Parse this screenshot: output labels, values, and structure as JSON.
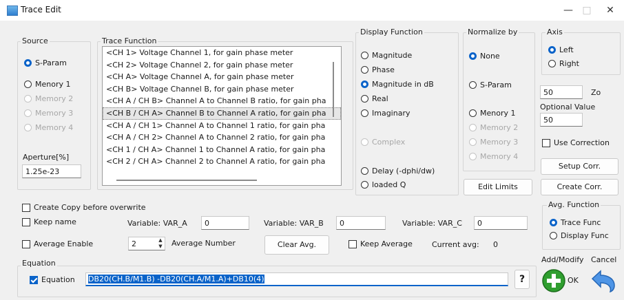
{
  "window": {
    "title": "Trace Edit",
    "minimize": "—",
    "maximize": "□",
    "close": "✕"
  },
  "source": {
    "label": "Source",
    "options": [
      {
        "label": "S-Param",
        "selected": true,
        "disabled": false
      },
      {
        "label": "Menory 1",
        "selected": false,
        "disabled": false
      },
      {
        "label": "Memory 2",
        "selected": false,
        "disabled": true
      },
      {
        "label": "Memory 3",
        "selected": false,
        "disabled": true
      },
      {
        "label": "Memory 4",
        "selected": false,
        "disabled": true
      }
    ],
    "aperture_label": "Aperture[%]",
    "aperture_value": "1.25e-23"
  },
  "trace_function": {
    "label": "Trace Function",
    "items": [
      "<CH 1> Voltage Channel 1, for gain phase meter",
      "<CH 2> Voltage Channel 2, for gain phase meter",
      "<CH A> Voltage Channel A, for gain phase meter",
      "<CH B> Voltage Channel B, for gain phase meter",
      "<CH A / CH B> Channel A to Channel B ratio, for gain pha",
      "<CH B / CH A> Channel B to Channel A ratio, for gain pha",
      "<CH A / CH 1> Channel A to Channel 1 ratio, for gain pha",
      "<CH A / CH 2> Channel A to Channel 2 ratio, for gain pha",
      "<CH 1 / CH A> Channel 1 to Channel A ratio, for gain pha",
      "<CH 2 / CH A> Channel 2 to Channel A ratio, for gain pha"
    ],
    "selected_index": 5
  },
  "display_function": {
    "label": "Display Function",
    "options": [
      {
        "label": "Magnitude",
        "selected": false,
        "disabled": false
      },
      {
        "label": "Phase",
        "selected": false,
        "disabled": false
      },
      {
        "label": "Magnitude in dB",
        "selected": true,
        "disabled": false
      },
      {
        "label": "Real",
        "selected": false,
        "disabled": false
      },
      {
        "label": "Imaginary",
        "selected": false,
        "disabled": false
      },
      {
        "label": "Complex",
        "selected": false,
        "disabled": true
      },
      {
        "label": "Delay (-dphi/dw)",
        "selected": false,
        "disabled": false
      },
      {
        "label": "loaded Q",
        "selected": false,
        "disabled": false
      }
    ]
  },
  "normalize_by": {
    "label": "Normalize by",
    "options": [
      {
        "label": "None",
        "selected": true,
        "disabled": false
      },
      {
        "label": "S-Param",
        "selected": false,
        "disabled": false
      },
      {
        "label": "Menory 1",
        "selected": false,
        "disabled": false
      },
      {
        "label": "Memory 2",
        "selected": false,
        "disabled": true
      },
      {
        "label": "Memory 3",
        "selected": false,
        "disabled": true
      },
      {
        "label": "Memory 4",
        "selected": false,
        "disabled": true
      }
    ],
    "edit_limits": "Edit Limits"
  },
  "axis": {
    "label": "Axis",
    "options": [
      {
        "label": "Left",
        "selected": true
      },
      {
        "label": "Right",
        "selected": false
      }
    ],
    "zo_value": "50",
    "zo_label": "Zo",
    "optional_label": "Optional Value",
    "optional_value": "50",
    "use_correction": "Use Correction",
    "setup_corr": "Setup Corr.",
    "create_corr": "Create Corr."
  },
  "options": {
    "create_copy": "Create Copy before overwrite",
    "keep_name": "Keep name",
    "var_a_label": "Variable: VAR_A",
    "var_a_value": "0",
    "var_b_label": "Variable: VAR_B",
    "var_b_value": "0",
    "var_c_label": "Variable: VAR_C",
    "var_c_value": "0",
    "average_enable": "Average Enable",
    "average_number_value": "2",
    "average_number_label": "Average Number",
    "clear_avg": "Clear Avg.",
    "keep_average": "Keep Average",
    "current_avg_label": "Current avg:",
    "current_avg_value": "0"
  },
  "avg_function": {
    "label": "Avg. Function",
    "options": [
      {
        "label": "Trace Func",
        "selected": true
      },
      {
        "label": "Display Func",
        "selected": false
      }
    ]
  },
  "equation": {
    "group_label": "Equation",
    "checkbox_label": "Equation",
    "value": "DB20(CH.B/M1.B) -DB20(CH.A/M1.A)+DB10(4)",
    "help": "?"
  },
  "actions": {
    "add_modify": "Add/Modify",
    "cancel": "Cancel",
    "ok": "OK"
  }
}
